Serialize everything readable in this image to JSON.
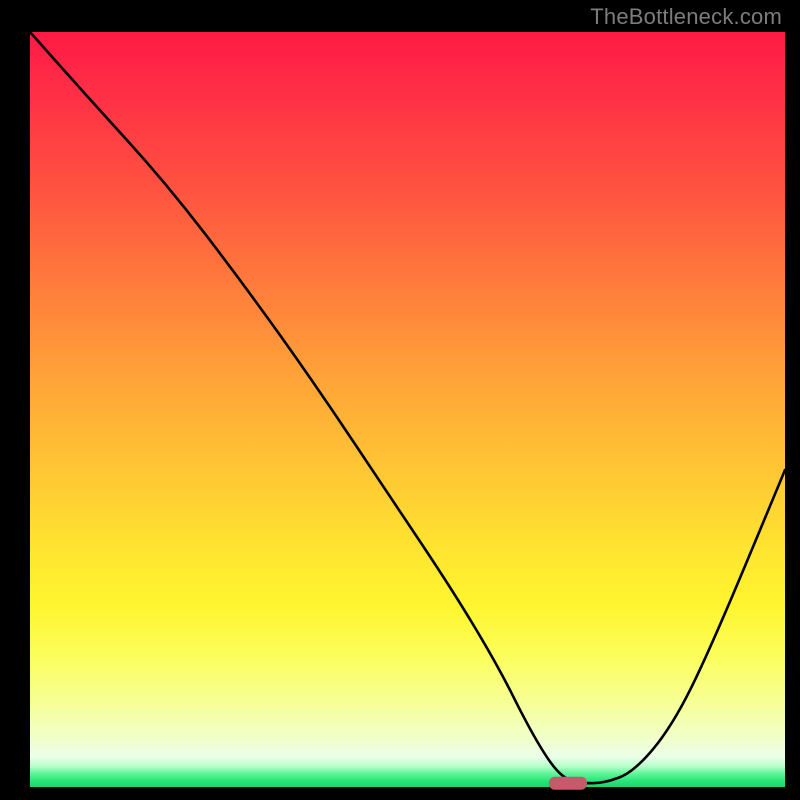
{
  "watermark": "TheBottleneck.com",
  "colors": {
    "background": "#000000",
    "gradient_top": "#ff1a44",
    "gradient_mid": "#ffe330",
    "gradient_bottom": "#17d96a",
    "curve": "#000000",
    "marker": "#c9586b"
  },
  "chart_data": {
    "type": "line",
    "title": "",
    "xlabel": "",
    "ylabel": "",
    "xlim": [
      0,
      100
    ],
    "ylim": [
      0,
      100
    ],
    "grid": false,
    "legend": null,
    "annotations": [],
    "background_metric": "bottleneck severity (top=high/red, bottom=low/green)",
    "series": [
      {
        "name": "bottleneck-curve",
        "x": [
          0,
          8,
          18,
          28,
          38,
          48,
          56,
          62,
          66,
          69,
          71,
          73,
          76,
          80,
          85,
          90,
          100
        ],
        "values": [
          100,
          91,
          80,
          67,
          53,
          38,
          26,
          16,
          8,
          3,
          1,
          0.5,
          0.5,
          2,
          8,
          18,
          42
        ]
      }
    ],
    "marker": {
      "x_start": 69,
      "x_end": 73,
      "y": 0.5,
      "shape": "rounded-rect",
      "note": "optimal point indicator"
    }
  }
}
